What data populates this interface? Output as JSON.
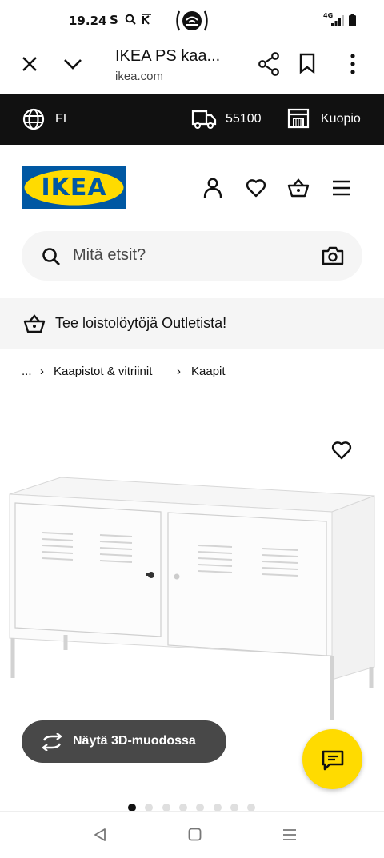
{
  "status_bar": {
    "time": "19.24",
    "icons": [
      "S",
      "search-q-icon",
      "K-icon",
      "hotspot-icon",
      "4G",
      "signal-icon",
      "battery-icon"
    ]
  },
  "browser": {
    "page_title": "IKEA PS kaa...",
    "url": "ikea.com"
  },
  "top_strip": {
    "language": "FI",
    "postal_code": "55100",
    "store": "Kuopio"
  },
  "header": {
    "logo_text": "IKEA",
    "colors": {
      "brand_blue": "#0058a3",
      "brand_yellow": "#ffdb00"
    }
  },
  "search": {
    "placeholder": "Mitä etsit?"
  },
  "promo": {
    "label": "Tee loistolöytöjä Outletista!"
  },
  "breadcrumb": {
    "items": [
      "...",
      "Kaapistot & vitriinit",
      "Kaapit"
    ]
  },
  "product": {
    "view_3d_label": "Näytä 3D-muodossa",
    "carousel": {
      "total": 8,
      "active": 1
    }
  }
}
